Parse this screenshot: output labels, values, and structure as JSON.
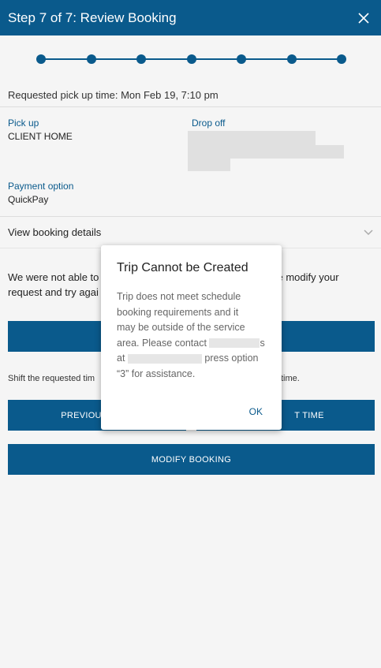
{
  "header": {
    "title": "Step 7 of 7: Review Booking",
    "close_icon": "close-icon"
  },
  "progress": {
    "steps": 7,
    "current": 7
  },
  "pickup_time": "Requested pick up time: Mon Feb 19, 7:10 pm",
  "details": {
    "pickup_label": "Pick up",
    "pickup_value": "CLIENT HOME",
    "dropoff_label": "Drop off",
    "payment_label": "Payment option",
    "payment_value": "QuickPay"
  },
  "view_details": {
    "label": "View booking details",
    "icon": "chevron-down-icon"
  },
  "background": {
    "message_left": "We were not able to",
    "message_right": "se modify your",
    "message_line2": "request and try agai",
    "shift_left": "Shift the requested tim",
    "shift_right": "time.",
    "prev_button": "PREVIOU",
    "next_button": "T TIME",
    "modify_button": "MODIFY BOOKING"
  },
  "modal": {
    "title": "Trip Cannot be Created",
    "body_line1": "Trip does not meet schedule",
    "body_line2": "booking requirements and it",
    "body_line3": "may be outside of the service",
    "body_line4a": "area. Please contact ",
    "body_line4b": "s",
    "body_line5a": "at ",
    "body_line5b": " press option",
    "body_line6": "“3” for assistance.",
    "ok_label": "OK"
  },
  "colors": {
    "primary": "#0a5a8c",
    "background": "#f5f5f5"
  }
}
